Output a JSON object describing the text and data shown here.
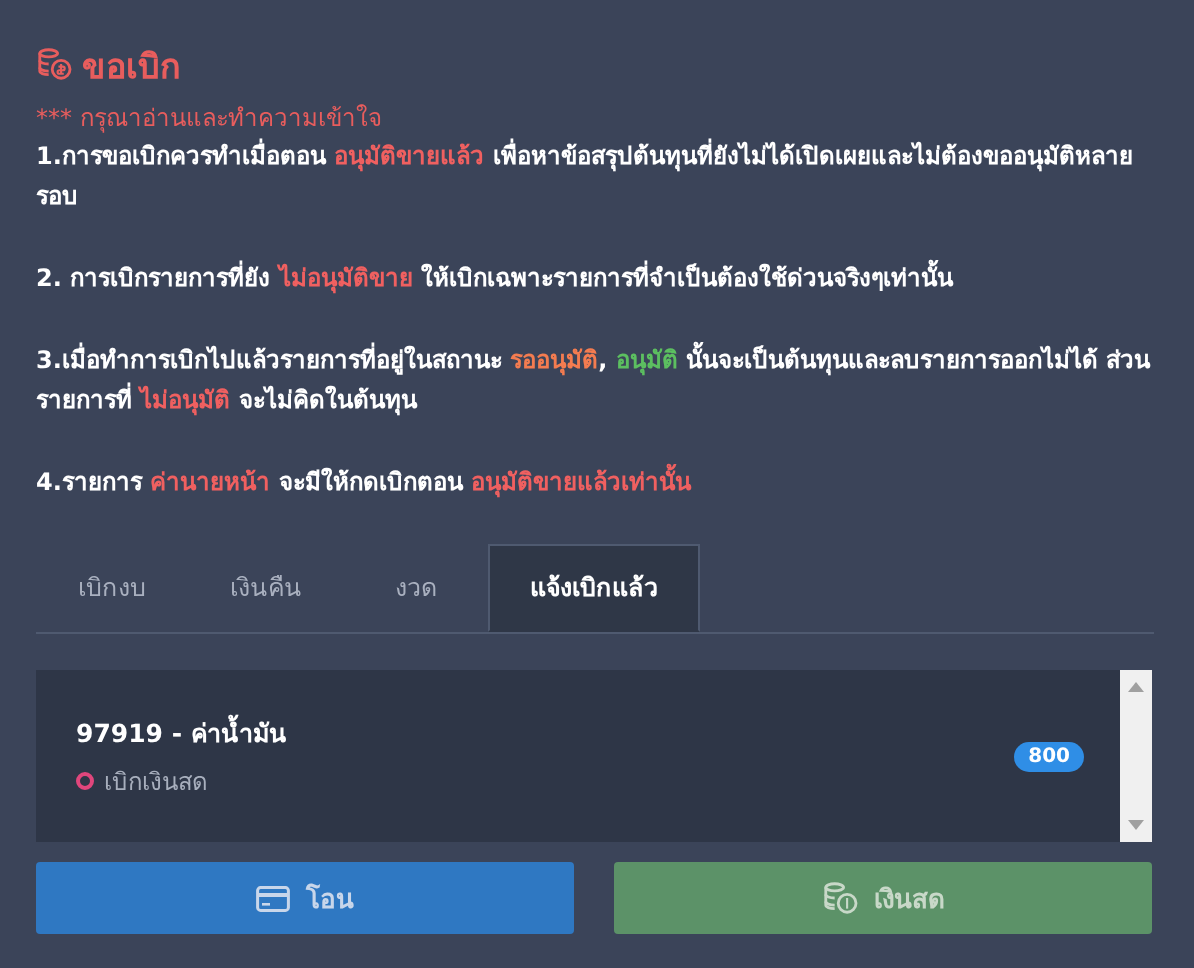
{
  "title": "ขอเบิก",
  "notice": "*** กรุณาอ่านและทำความเข้าใจ",
  "paragraphs": [
    [
      {
        "text": "1.การขอเบิกควรทำเมื่อตอน "
      },
      {
        "text": "อนุมัติขายแล้ว",
        "color": "#f06060"
      },
      {
        "text": " เพื่อหาข้อสรุปต้นทุนที่ยังไม่ได้เปิดเผยและไม่ต้องขออนุมัติหลายรอบ"
      }
    ],
    [
      {
        "text": "2. การเบิกรายการที่ยัง "
      },
      {
        "text": "ไม่อนุมัติขาย",
        "color": "#f06060"
      },
      {
        "text": " ให้เบิกเฉพาะรายการที่จำเป็นต้องใช้ด่วนจริงๆเท่านั้น"
      }
    ],
    [
      {
        "text": "3.เมื่อทำการเบิกไปแล้วรายการที่อยู่ในสถานะ "
      },
      {
        "text": "รออนุมัติ",
        "color": "#f47c50"
      },
      {
        "text": ", "
      },
      {
        "text": "อนุมัติ",
        "color": "#5cbf60"
      },
      {
        "text": " นั้นจะเป็นต้นทุนและลบรายการออกไม่ได้ ส่วนรายการที่ "
      },
      {
        "text": "ไม่อนุมัติ",
        "color": "#f06060"
      },
      {
        "text": " จะไม่คิดในต้นทุน"
      }
    ],
    [
      {
        "text": "4.รายการ "
      },
      {
        "text": "ค่านายหน้า",
        "color": "#f06060"
      },
      {
        "text": " จะมีให้กดเบิกตอน "
      },
      {
        "text": "อนุมัติขายแล้วเท่านั้น",
        "color": "#f06060"
      }
    ]
  ],
  "tabs": [
    {
      "label": "เบิกงบ",
      "selected": false
    },
    {
      "label": "เงินคืน",
      "selected": false
    },
    {
      "label": "งวด",
      "selected": false
    },
    {
      "label": "แจ้งเบิกแล้ว",
      "selected": true
    }
  ],
  "items": [
    {
      "title": "97919 - ค่าน้ำมัน",
      "status": "เบิกเงินสด",
      "color": "#e0467c",
      "amount": "800"
    }
  ],
  "buttons": [
    {
      "label": "โอน",
      "kind": "transfer"
    },
    {
      "label": "เงินสด",
      "kind": "cash"
    }
  ]
}
